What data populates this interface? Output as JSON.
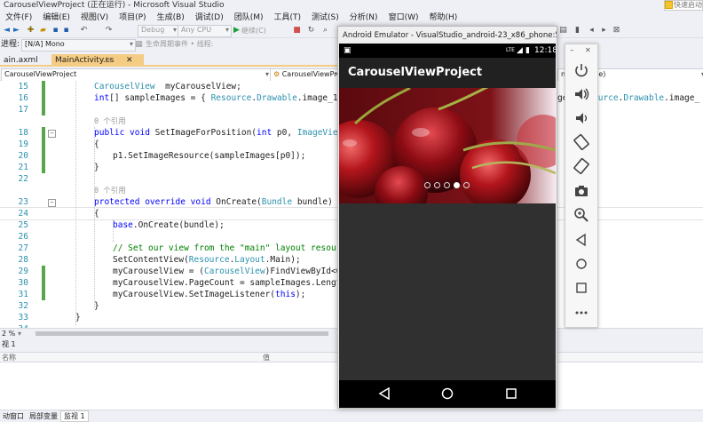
{
  "vs": {
    "title": "CarouselViewProject (正在运行) - Microsoft Visual Studio",
    "quick_launch": "快速启动",
    "menu": [
      "文件(F)",
      "编辑(E)",
      "视图(V)",
      "项目(P)",
      "生成(B)",
      "调试(D)",
      "团队(M)",
      "工具(T)",
      "测试(S)",
      "分析(N)",
      "窗口(W)",
      "帮助(H)"
    ],
    "toolbar": {
      "config": "Debug",
      "platform": "Any CPU",
      "continue": "继续(C)"
    },
    "process_label": "进程:",
    "process_value": "[N/A] Mono",
    "lifecycle": "生命周期事件 • 线程:",
    "tabs": {
      "axml": "ain.axml",
      "main": "MainActivity.cs"
    },
    "nav": {
      "project": "CarouselViewProject",
      "class": "CarouselViewProject",
      "member": "ndle bundle)"
    },
    "zoom": "2 %",
    "watch": {
      "title": "视 1",
      "col_name": "名称",
      "col_value": "值"
    },
    "bottom_tabs": [
      "动窗口",
      "局部变量",
      "监视 1"
    ]
  },
  "code": [
    {
      "n": "15",
      "indent": 1,
      "parts": [
        [
          "ty",
          "CarouselView"
        ],
        [
          "",
          "  myCarouselView;"
        ]
      ]
    },
    {
      "n": "16",
      "indent": 1,
      "parts": [
        [
          "kw",
          "int"
        ],
        [
          "",
          "[] sampleImages = { "
        ],
        [
          "ty",
          "Resource"
        ],
        [
          "",
          "."
        ],
        [
          "ty",
          "Drawable"
        ],
        [
          "",
          ".image_1, R"
        ]
      ],
      "tail": "ge, Resource.Drawable.image_"
    },
    {
      "n": "17",
      "indent": 1,
      "parts": []
    },
    {
      "n": "",
      "indent": 1,
      "parts": [
        [
          "ref",
          "0 个引用"
        ]
      ]
    },
    {
      "n": "18",
      "indent": 1,
      "parts": [
        [
          "kw",
          "public void"
        ],
        [
          "",
          " SetImageForPosition("
        ],
        [
          "kw",
          "int"
        ],
        [
          "",
          " p0, "
        ],
        [
          "ty",
          "ImageView"
        ],
        [
          "",
          " p"
        ]
      ],
      "fold": true
    },
    {
      "n": "19",
      "indent": 1,
      "parts": [
        [
          "",
          "{"
        ]
      ]
    },
    {
      "n": "20",
      "indent": 2,
      "parts": [
        [
          "",
          "p1.SetImageResource(sampleImages[p0]);"
        ]
      ]
    },
    {
      "n": "21",
      "indent": 1,
      "parts": [
        [
          "",
          "}"
        ]
      ]
    },
    {
      "n": "22",
      "indent": 1,
      "parts": []
    },
    {
      "n": "",
      "indent": 1,
      "parts": [
        [
          "ref",
          "0 个引用"
        ]
      ]
    },
    {
      "n": "23",
      "indent": 1,
      "parts": [
        [
          "kw",
          "protected override void"
        ],
        [
          "",
          " OnCreate("
        ],
        [
          "ty",
          "Bundle"
        ],
        [
          "",
          " bundle)"
        ]
      ],
      "fold": true
    },
    {
      "n": "24",
      "indent": 1,
      "parts": [
        [
          "",
          "{"
        ]
      ]
    },
    {
      "n": "25",
      "indent": 2,
      "parts": [
        [
          "kw",
          "base"
        ],
        [
          "",
          ".OnCreate(bundle);"
        ]
      ]
    },
    {
      "n": "26",
      "indent": 2,
      "parts": []
    },
    {
      "n": "27",
      "indent": 2,
      "parts": [
        [
          "cm",
          "// Set our view from the \"main\" layout resource"
        ]
      ]
    },
    {
      "n": "28",
      "indent": 2,
      "parts": [
        [
          "",
          "SetContentView("
        ],
        [
          "ty",
          "Resource"
        ],
        [
          "",
          "."
        ],
        [
          "ty",
          "Layout"
        ],
        [
          "",
          ".Main);"
        ]
      ]
    },
    {
      "n": "29",
      "indent": 2,
      "parts": [
        [
          "",
          "myCarouselView = ("
        ],
        [
          "ty",
          "CarouselView"
        ],
        [
          "",
          ")FindViewById<Car"
        ]
      ]
    },
    {
      "n": "30",
      "indent": 2,
      "parts": [
        [
          "",
          "myCarouselView.PageCount = sampleImages.Length;"
        ]
      ]
    },
    {
      "n": "31",
      "indent": 2,
      "parts": [
        [
          "",
          "myCarouselView.SetImageListener("
        ],
        [
          "kw",
          "this"
        ],
        [
          "",
          ");"
        ]
      ]
    },
    {
      "n": "32",
      "indent": 1,
      "parts": [
        [
          "",
          "}"
        ]
      ]
    },
    {
      "n": "33",
      "indent": 0,
      "parts": [
        [
          "",
          "}"
        ]
      ]
    },
    {
      "n": "34",
      "indent": 0,
      "parts": []
    }
  ],
  "emulator": {
    "title": "Android Emulator - VisualStudio_android-23_x86_phone:5554",
    "status_time": "12:18",
    "status_signal": "LTE",
    "app_title": "CarouselViewProject",
    "page_count": 5,
    "current_page": 4,
    "colors": {
      "appbar": "#212121",
      "background": "#303030",
      "indicator": "#ffffff"
    }
  },
  "emu_panel": {
    "buttons": [
      "power-icon",
      "volume-up-icon",
      "volume-down-icon",
      "rotate-left-icon",
      "rotate-right-icon",
      "camera-icon",
      "zoom-icon",
      "back-icon",
      "home-icon",
      "overview-icon",
      "more-icon"
    ],
    "close": "✕",
    "minimize": "–"
  }
}
